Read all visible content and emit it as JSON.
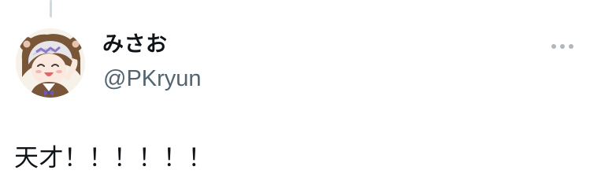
{
  "tweet": {
    "author": {
      "display_name": "みさお",
      "handle": "@PKryun",
      "avatar_icon": "anime-character-avatar"
    },
    "more_icon": "more-horizontal-icon",
    "text": "天才！！！！！！",
    "colors": {
      "text_primary": "#0f1419",
      "text_secondary": "#536471",
      "thread_line": "#cfd9de",
      "more_icon": "#b0b8bf"
    }
  }
}
